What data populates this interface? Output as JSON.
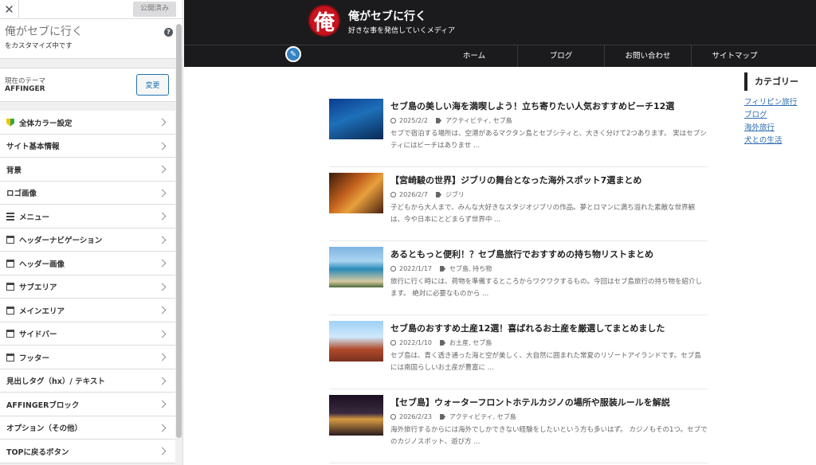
{
  "customizer": {
    "publish_label": "公開済み",
    "site_title": "俺がセブに行く",
    "customizing_label": "をカスタマイズ中です",
    "theme_label": "現在のテーマ",
    "theme_name": "AFFINGER",
    "change_label": "変更",
    "menu": [
      {
        "label": "全体カラー設定",
        "icon": "shield-icon"
      },
      {
        "label": "サイト基本情報",
        "icon": ""
      },
      {
        "label": "背景",
        "icon": ""
      },
      {
        "label": "ロゴ画像",
        "icon": ""
      },
      {
        "label": "メニュー",
        "icon": "list-icon"
      },
      {
        "label": "ヘッダーナビゲーション",
        "icon": "window-icon"
      },
      {
        "label": "ヘッダー画像",
        "icon": "window-icon"
      },
      {
        "label": "サブエリア",
        "icon": "window-icon"
      },
      {
        "label": "メインエリア",
        "icon": "window-icon"
      },
      {
        "label": "サイドバー",
        "icon": "window-icon"
      },
      {
        "label": "フッター",
        "icon": "window-icon"
      },
      {
        "label": "見出しタグ（hx）/ テキスト",
        "icon": ""
      },
      {
        "label": "AFFINGERブロック",
        "icon": ""
      },
      {
        "label": "オプション（その他）",
        "icon": ""
      },
      {
        "label": "TOPに戻るボタン",
        "icon": ""
      }
    ]
  },
  "site": {
    "logo_char": "俺",
    "title": "俺がセブに行く",
    "tagline": "好きな事を発信していくメディア",
    "nav": [
      "ホーム",
      "ブログ",
      "お問い合わせ",
      "サイトマップ"
    ]
  },
  "posts": [
    {
      "title": "セブ島の美しい海を満喫しよう！立ち寄りたい人気おすすめビーチ12選",
      "date": "2025/2/2",
      "cats": "アクティビティ, セブ島",
      "excerpt": "セブで宿泊する場所は、空港があるマクタン島とセブシティと、大きく分けて2つあります。 実はセブシティにはビーチはありませ ..."
    },
    {
      "title": "【宮崎駿の世界】ジブリの舞台となった海外スポット7選まとめ",
      "date": "2026/2/7",
      "cats": "ジブリ",
      "excerpt": "子どもから大人まで、みんな大好きなスタジオジブリの作品。夢とロマンに満ち溢れた素敵な世界観は、今や日本にとどまらず世界中 ..."
    },
    {
      "title": "あるともっと便利！？セブ島旅行でおすすめの持ち物リストまとめ",
      "date": "2022/1/17",
      "cats": "セブ島, 持ち物",
      "excerpt": "旅行に行く時には、荷物を準備するところからワクワクするもの。今回はセブ島旅行の持ち物を紹介します。 絶対に必要なものから ..."
    },
    {
      "title": "セブ島のおすすめ土産12選！喜ばれるお土産を厳選してまとめました",
      "date": "2022/1/10",
      "cats": "お土産, セブ島",
      "excerpt": "セブ島は、青く透き通った海と空が美しく、大自然に囲まれた常夏のリゾートアイランドです。セブ島には南国らしいお土産が豊富に ..."
    },
    {
      "title": "【セブ島】ウォーターフロントホテルカジノの場所や服装ルールを解説",
      "date": "2026/2/23",
      "cats": "アクティビティ, セブ島",
      "excerpt": "海外旅行するからには海外でしかできない経験をしたいという方も多いはず。 カジノもその1つ。セブでのカジノスポット、遊び方 ..."
    }
  ],
  "sidebar": {
    "heading": "カテゴリー",
    "categories": [
      "フィリピン旅行",
      "ブログ",
      "海外旅行",
      "犬との生活"
    ]
  }
}
